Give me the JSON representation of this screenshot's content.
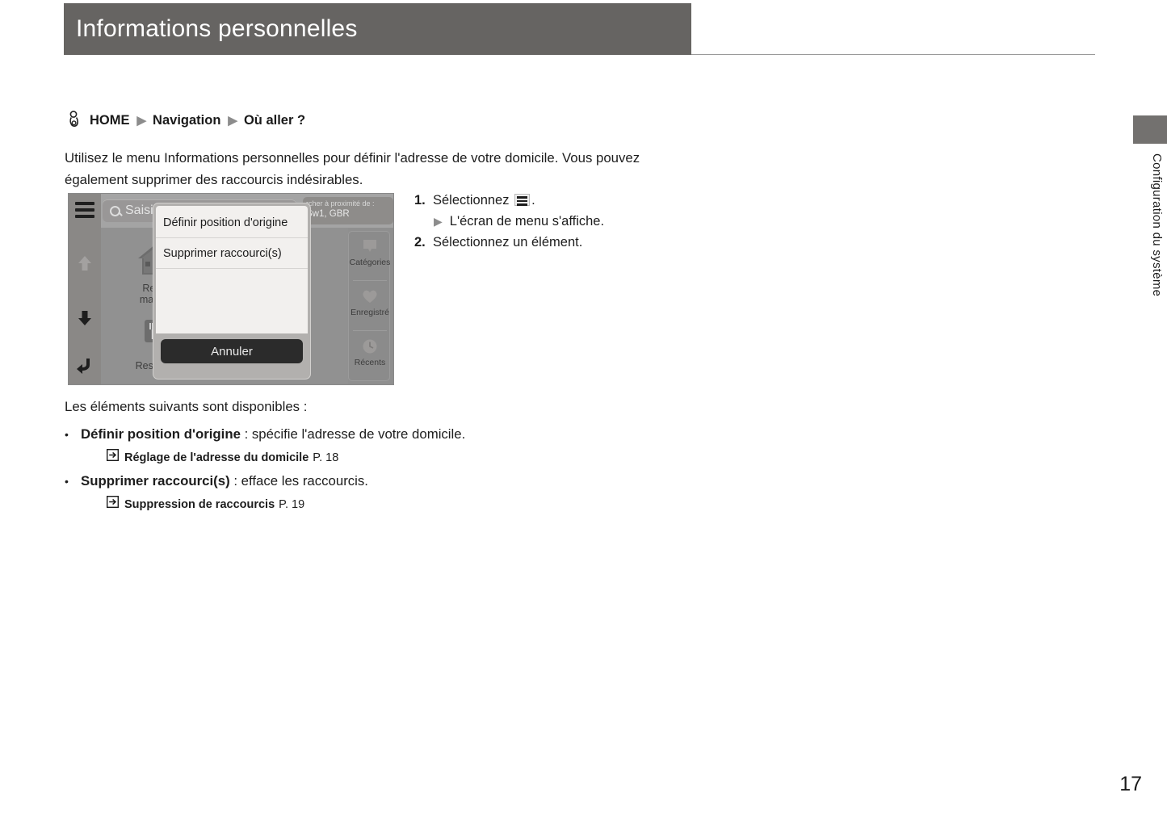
{
  "header": {
    "title": "Informations personnelles"
  },
  "side_tab": {
    "label": "Configuration du système"
  },
  "breadcrumb": {
    "icon": "hand-press-icon",
    "items": [
      "HOME",
      "Navigation",
      "Où aller ?"
    ],
    "separator": "▶"
  },
  "intro": {
    "text": "Utilisez le menu Informations personnelles pour définir l'adresse de votre domicile. Vous pouvez également supprimer des raccourcis indésirables."
  },
  "screenshot": {
    "search": {
      "icon": "search-icon",
      "value": "Saisi"
    },
    "near": {
      "line1": "rcher à proximité de :",
      "line2": "Sw1, GBR"
    },
    "left_icons": [
      "hamburger-menu-icon",
      "arrow-up-icon",
      "arrow-down-icon",
      "back-arrow-icon"
    ],
    "tiles": [
      {
        "icon": "house-icon",
        "label": "Retou\nmaison"
      },
      {
        "icon": "restaurant-icon",
        "label": "Restaura"
      }
    ],
    "right_tiles": [
      {
        "icon": "map-pin-icon",
        "label": "Catégories"
      },
      {
        "icon": "heart-icon",
        "label": "Enregistré"
      },
      {
        "icon": "clock-icon",
        "label": "Récents"
      }
    ],
    "dialog": {
      "items": [
        "Définir position d'origine",
        "Supprimer raccourci(s)"
      ],
      "cancel_label": "Annuler"
    },
    "bg_partial_text": "s"
  },
  "steps": [
    {
      "num": "1.",
      "text_before": "Sélectionnez",
      "icon": "hamburger-menu-icon",
      "text_after": ".",
      "sub": "L'écran de menu s'affiche.",
      "sub_arrow": "▶"
    },
    {
      "num": "2.",
      "text_before": "Sélectionnez un élément.",
      "icon": "",
      "text_after": "",
      "sub": "",
      "sub_arrow": ""
    }
  ],
  "bottom": {
    "lead": "Les éléments suivants sont disponibles :",
    "bullet_char": "•",
    "items": [
      {
        "term": "Définir position d'origine",
        "desc": " : spécifie l'adresse de votre domicile.",
        "ref_icon": "reference-arrow-icon",
        "ref_title": "Réglage de l'adresse du domicile",
        "ref_page": "P. 18"
      },
      {
        "term": "Supprimer raccourci(s)",
        "desc": " : efface les raccourcis.",
        "ref_icon": "reference-arrow-icon",
        "ref_title": "Suppression de raccourcis",
        "ref_page": "P. 19"
      }
    ]
  },
  "page_number": "17",
  "colors": {
    "header_gray": "#666462",
    "tab_gray": "#73716f",
    "device_bg": "#8f8f8f",
    "dialog_list": "#f2f0ee",
    "cancel_btn": "#2b2b2b"
  }
}
